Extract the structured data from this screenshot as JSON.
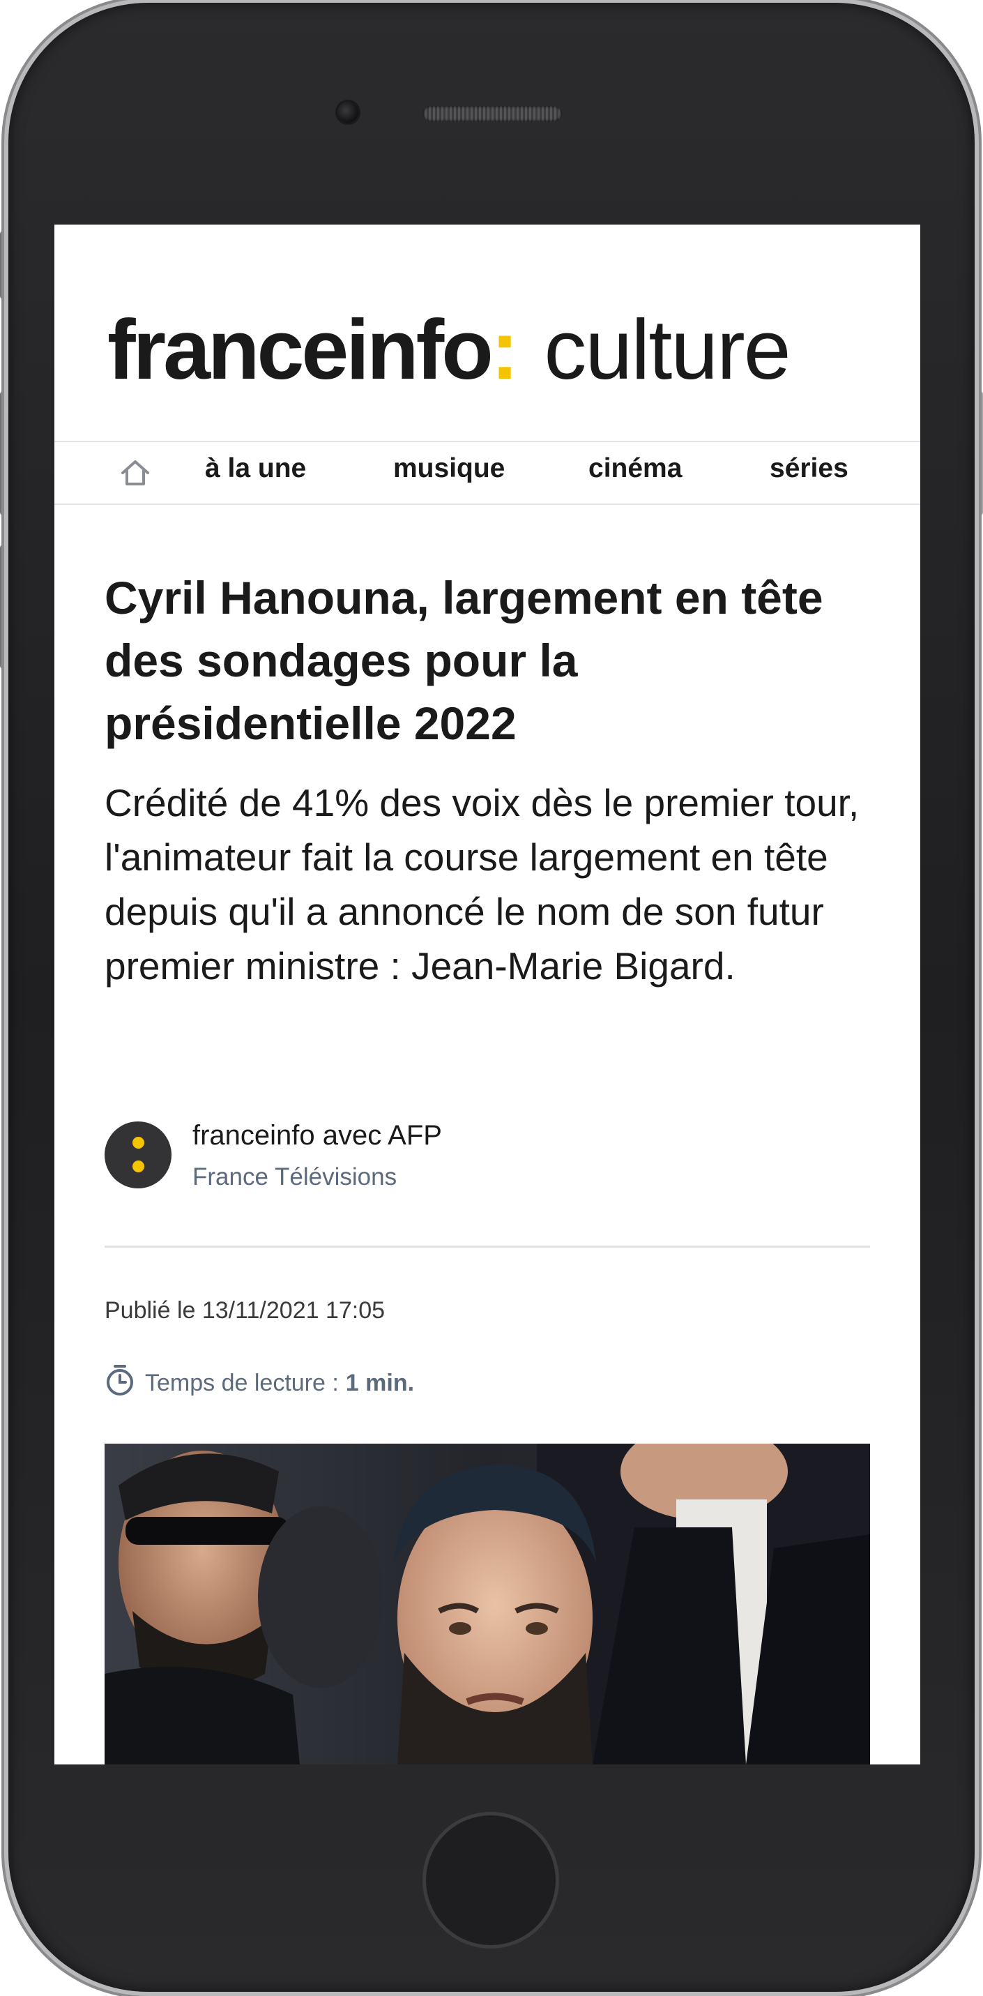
{
  "header": {
    "logo_main": "franceinfo",
    "logo_colon": ":",
    "logo_section": "culture"
  },
  "nav": {
    "home_icon": "home-icon",
    "items": [
      {
        "label": "à la une"
      },
      {
        "label": "musique"
      },
      {
        "label": "cinéma"
      },
      {
        "label": "séries"
      }
    ]
  },
  "article": {
    "title": "Cyril Hanouna, largement en tête des sondages pour la présidentielle 2022",
    "lead": "Crédité de 41% des voix dès le premier tour, l'animateur fait la course largement en tête depuis qu'il a annoncé le nom de son futur premier ministre : Jean-Marie Bigard.",
    "author": {
      "name": "franceinfo avec AFP",
      "organization": "France Télévisions",
      "avatar_icon": "franceinfo-colon-logo-icon"
    },
    "published": "Publié le 13/11/2021 17:05",
    "reading_time_label": "Temps de lecture :",
    "reading_time_value": "1 min.",
    "reading_icon": "stopwatch-icon"
  },
  "colors": {
    "brand_yellow": "#f5c400",
    "text_dark": "#1a1a1a",
    "text_muted": "#5b6a7c",
    "divider": "#e2e3e6"
  }
}
